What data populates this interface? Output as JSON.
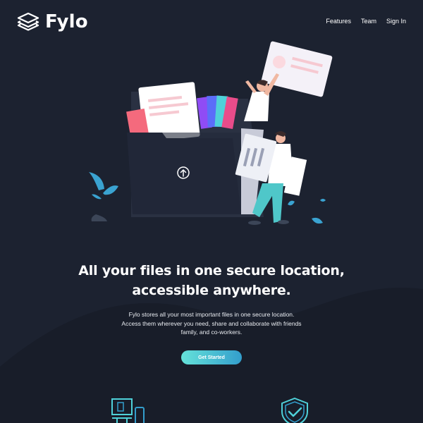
{
  "brand": {
    "name": "Fylo"
  },
  "nav": {
    "items": [
      "Features",
      "Team",
      "Sign In"
    ]
  },
  "hero": {
    "headline": [
      "All your files in one secure location,",
      "accessible anywhere."
    ],
    "description": [
      "Fylo stores all your most important files in one secure location.",
      "Access them wherever you need, share and collaborate with friends",
      "family, and co-workers."
    ],
    "cta_label": "Get Started"
  },
  "icons": {
    "logo": "stacked-layers-icon",
    "upload": "upload-arrow-icon",
    "features": [
      "device-access-icon",
      "shield-check-icon"
    ]
  },
  "colors": {
    "background": "#1c2230",
    "background_curve": "#181d29",
    "accent_start": "#65e2d9",
    "accent_end": "#339ecc",
    "text": "#ffffff"
  }
}
